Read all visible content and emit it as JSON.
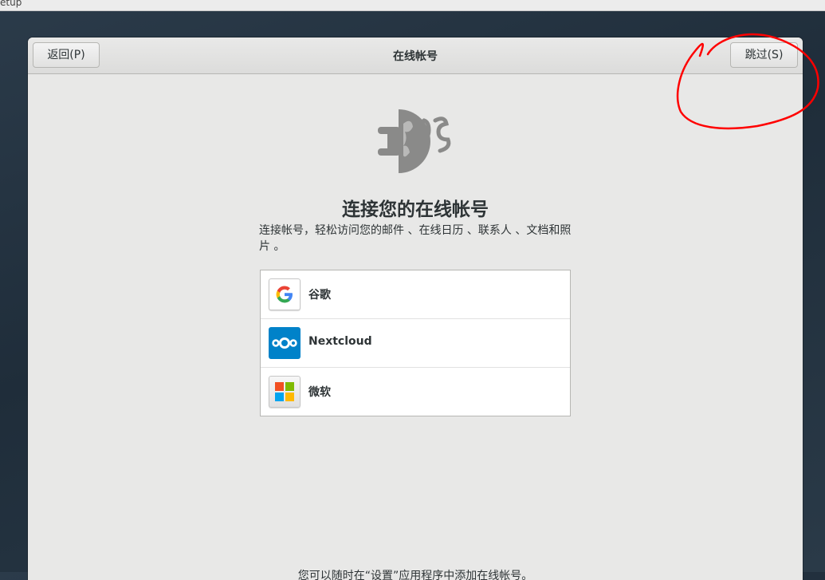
{
  "topbar": {
    "title": "etup"
  },
  "headerbar": {
    "back_label": "返回(P)",
    "title": "在线帐号",
    "skip_label": "跳过(S)"
  },
  "main": {
    "heading": "连接您的在线帐号",
    "description": "连接帐号，轻松访问您的邮件 、在线日历 、联系人 、文档和照片 。",
    "footer_hint": "您可以随时在“设置”应用程序中添加在线帐号。"
  },
  "accounts": [
    {
      "label": "谷歌",
      "icon": "google-icon"
    },
    {
      "label": "Nextcloud",
      "icon": "nextcloud-icon"
    },
    {
      "label": "微软",
      "icon": "microsoft-icon"
    }
  ],
  "colors": {
    "annotation": "#ff0000",
    "nextcloud": "#0082c9",
    "ms_red": "#f25022",
    "ms_green": "#7fba00",
    "ms_blue": "#00a4ef",
    "ms_yellow": "#ffb900"
  }
}
